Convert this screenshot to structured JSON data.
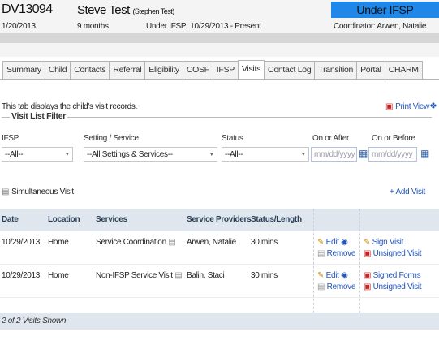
{
  "header": {
    "child_id": "DV13094",
    "child_name": "Steve Test",
    "child_alias": "(Stephen Test)",
    "dob": "1/20/2013",
    "age": "9 months",
    "ifsp_range": "Under IFSP: 10/29/2013 - Present",
    "status": "Under IFSP",
    "coordinator": "Coordinator: Arwen, Natalie"
  },
  "tabs": [
    {
      "label": "Summary"
    },
    {
      "label": "Child"
    },
    {
      "label": "Contacts"
    },
    {
      "label": "Referral"
    },
    {
      "label": "Eligibility"
    },
    {
      "label": "COSF"
    },
    {
      "label": "IFSP"
    },
    {
      "label": "Visits",
      "active": true
    },
    {
      "label": "Contact Log"
    },
    {
      "label": "Transition"
    },
    {
      "label": "Portal"
    },
    {
      "label": "CHARM"
    }
  ],
  "description": "This tab displays the child's visit records.",
  "print_view": "Print View",
  "filter": {
    "legend": "Visit List Filter",
    "ifsp_label": "IFSP",
    "ifsp_value": "--All--",
    "setting_label": "Setting / Service",
    "setting_value": "--All Settings & Services--",
    "status_label": "Status",
    "status_value": "--All--",
    "on_after_label": "On or After",
    "on_after_placeholder": "mm/dd/yyyy",
    "on_before_label": "On or Before",
    "on_before_placeholder": "mm/dd/yyyy"
  },
  "simultaneous_visit": "Simultaneous Visit",
  "add_visit": "+ Add Visit",
  "table": {
    "headers": {
      "date": "Date",
      "location": "Location",
      "services": "Services",
      "providers": "Service Providers",
      "status_length": "Status/Length"
    },
    "rows": [
      {
        "date": "10/29/2013",
        "location": "Home",
        "services": "Service Coordination",
        "providers": "Arwen, Natalie",
        "length": "30 mins",
        "edit": "Edit",
        "remove": "Remove",
        "action1": "Sign Visit",
        "action2": "Unsigned Visit"
      },
      {
        "date": "10/29/2013",
        "location": "Home",
        "services": "Non-IFSP Service Visit",
        "providers": "Balin, Staci",
        "length": "30 mins",
        "edit": "Edit",
        "remove": "Remove",
        "action1": "Signed Forms",
        "action2": "Unsigned Visit"
      }
    ]
  },
  "shown_count": "2 of 2 Visits Shown"
}
